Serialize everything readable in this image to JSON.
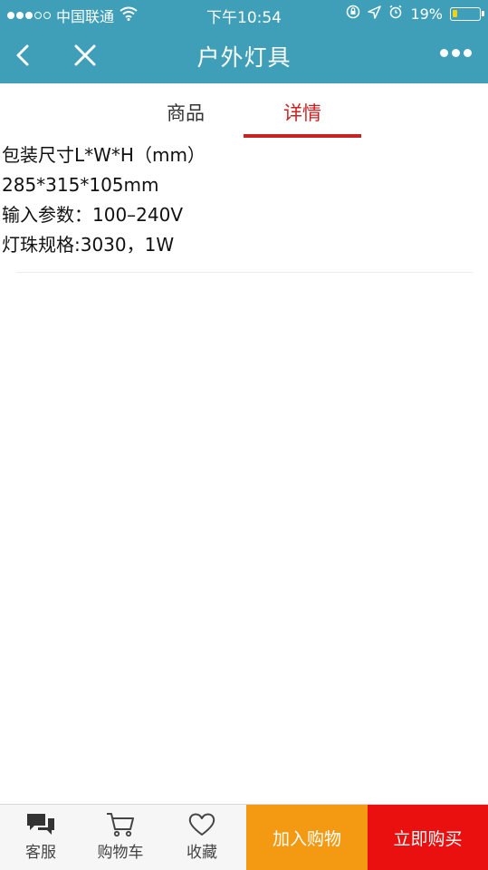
{
  "status_bar": {
    "carrier": "中国联通",
    "time": "下午10:54",
    "battery_percent": "19%",
    "battery_level": 0.19
  },
  "nav": {
    "title": "户外灯具"
  },
  "tabs": [
    {
      "label": "商品",
      "active": false
    },
    {
      "label": "详情",
      "active": true
    }
  ],
  "details": {
    "lines": [
      "包装尺寸L*W*H（mm）",
      "285*315*105mm",
      "输入参数：100–240V",
      "灯珠规格:3030，1W"
    ]
  },
  "toolbar": {
    "service_label": "客服",
    "cart_label": "购物车",
    "favorite_label": "收藏",
    "add_to_cart_label": "加入购物",
    "buy_now_label": "立即购买"
  },
  "colors": {
    "header_bg": "#3f9fb9",
    "active_tab": "#c92222",
    "add_button": "#f49a12",
    "buy_button": "#ea1010"
  },
  "icons": {
    "back": "chevron-left-icon",
    "close": "close-icon",
    "more": "more-dots-icon",
    "service": "chat-bubbles-icon",
    "cart": "cart-icon",
    "favorite": "heart-icon",
    "wifi": "wifi-icon",
    "location": "location-arrow-icon",
    "alarm": "alarm-icon",
    "rotation_lock": "rotation-lock-icon"
  }
}
